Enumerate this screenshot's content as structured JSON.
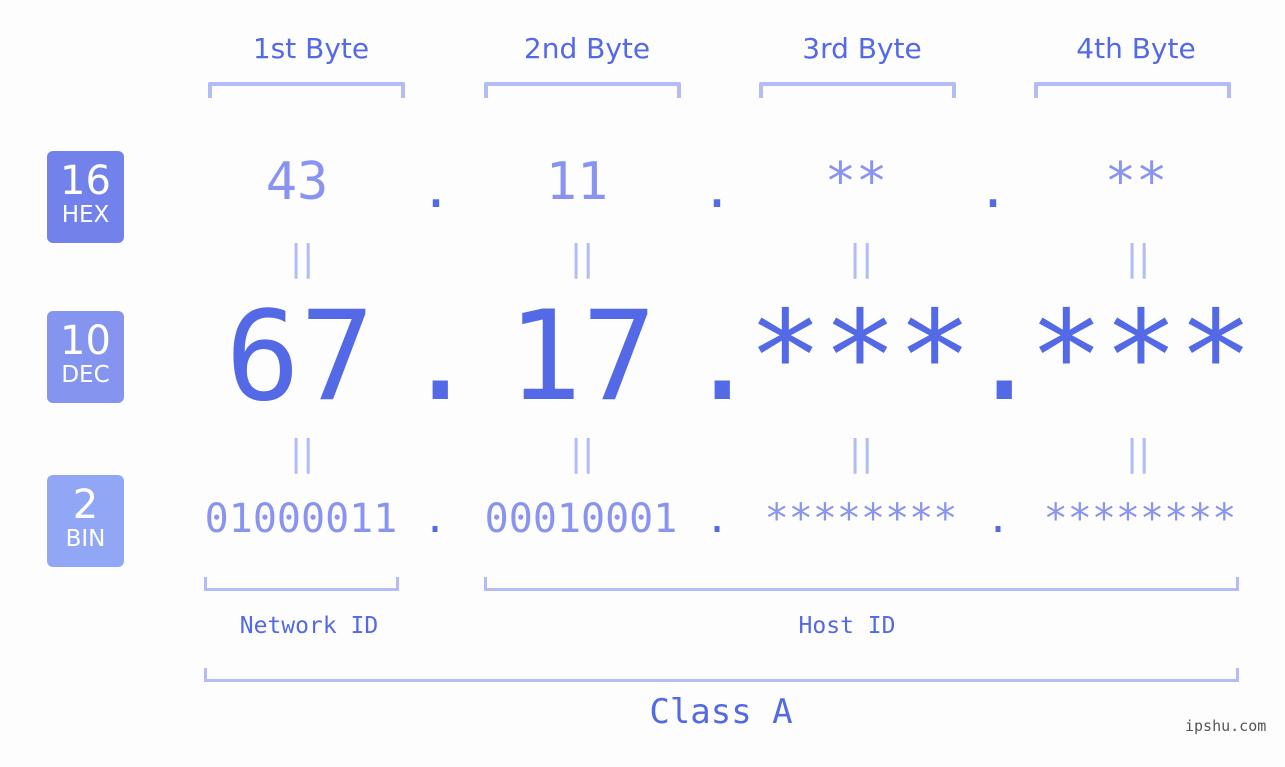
{
  "bytes": {
    "headers": [
      "1st Byte",
      "2nd Byte",
      "3rd Byte",
      "4th Byte"
    ]
  },
  "badges": {
    "hex": {
      "number": "16",
      "label": "HEX",
      "color": "#7282ea"
    },
    "dec": {
      "number": "10",
      "label": "DEC",
      "color": "#8494ef"
    },
    "bin": {
      "number": "2",
      "label": "BIN",
      "color": "#91a7f6"
    }
  },
  "ip": {
    "hex": [
      "43",
      "11",
      "**",
      "**"
    ],
    "dec": [
      "67",
      "17",
      "***",
      "***"
    ],
    "bin": [
      "01000011",
      "00010001",
      "********",
      "********"
    ],
    "separator": ".",
    "equals": "||"
  },
  "segments": {
    "network_id": "Network ID",
    "host_id": "Host ID",
    "class": "Class A"
  },
  "colors": {
    "accent": "#5369e6",
    "light_value": "#8894ef",
    "bracket": "#b3bcf6"
  },
  "watermark": "ipshu.com"
}
